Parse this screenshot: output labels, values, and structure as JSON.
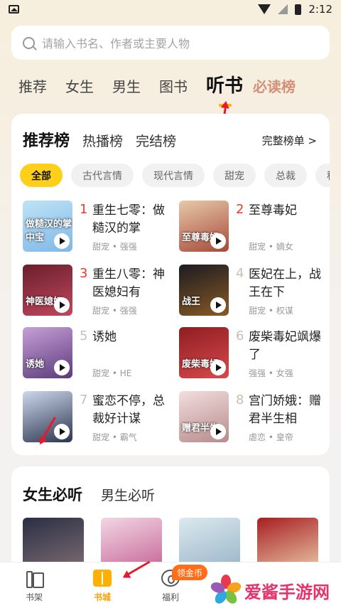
{
  "status": {
    "time": "2:12"
  },
  "search": {
    "placeholder": "请输入书名、作者或主要人物"
  },
  "channels": [
    "推荐",
    "女生",
    "男生",
    "图书",
    "听书",
    "必读榜"
  ],
  "card": {
    "tabs": [
      "推荐榜",
      "热播榜",
      "完结榜"
    ],
    "more": "完整榜单 >",
    "chips": [
      "全部",
      "古代言情",
      "现代言情",
      "甜宠",
      "总裁",
      "种田"
    ],
    "books": [
      {
        "rank": "1",
        "title": "重生七零：做糙汉的掌",
        "tags": "甜宠 • 强强",
        "cover_text": "做糙汉的掌中宝",
        "colors": [
          "#bfe3f7",
          "#7fb7e6"
        ]
      },
      {
        "rank": "2",
        "title": "至尊毒妃",
        "tags": "甜宠 • 嫡女",
        "cover_text": "至尊毒妃",
        "colors": [
          "#e8c9a9",
          "#a64a3a"
        ]
      },
      {
        "rank": "3",
        "title": "重生八零：神医媳妇有",
        "tags": "甜宠 • 强强",
        "cover_text": "神医媳妇",
        "colors": [
          "#6a1f2b",
          "#c0475e"
        ]
      },
      {
        "rank": "4",
        "title": "医妃在上，战王在下",
        "tags": "甜宠 • 权谋",
        "cover_text": "战王",
        "colors": [
          "#1b1b22",
          "#8a5a24"
        ]
      },
      {
        "rank": "5",
        "title": "诱她",
        "tags": "甜宠 • HE",
        "cover_text": "诱她",
        "colors": [
          "#c79fd6",
          "#5b3b7c"
        ]
      },
      {
        "rank": "6",
        "title": "废柴毒妃飒爆了",
        "tags": "强强 • 女强",
        "cover_text": "废柴毒妃",
        "colors": [
          "#8e1e22",
          "#d8494b"
        ]
      },
      {
        "rank": "7",
        "title": "蜜恋不停，总裁好计谋",
        "tags": "甜宠 • 霸气",
        "cover_text": "",
        "colors": [
          "#cdd8ec",
          "#2d3550"
        ]
      },
      {
        "rank": "8",
        "title": "宫门娇娥：赠君半生相",
        "tags": "虐恋 • 皇帝",
        "cover_text": "赠君半生",
        "colors": [
          "#f2dede",
          "#b88b8b"
        ]
      }
    ]
  },
  "card2": {
    "tabs": [
      "女生必听",
      "男生必听"
    ]
  },
  "nav": {
    "items": [
      "书架",
      "书城",
      "福利"
    ],
    "badge": "领金币"
  },
  "watermark": "爱酱手游网"
}
